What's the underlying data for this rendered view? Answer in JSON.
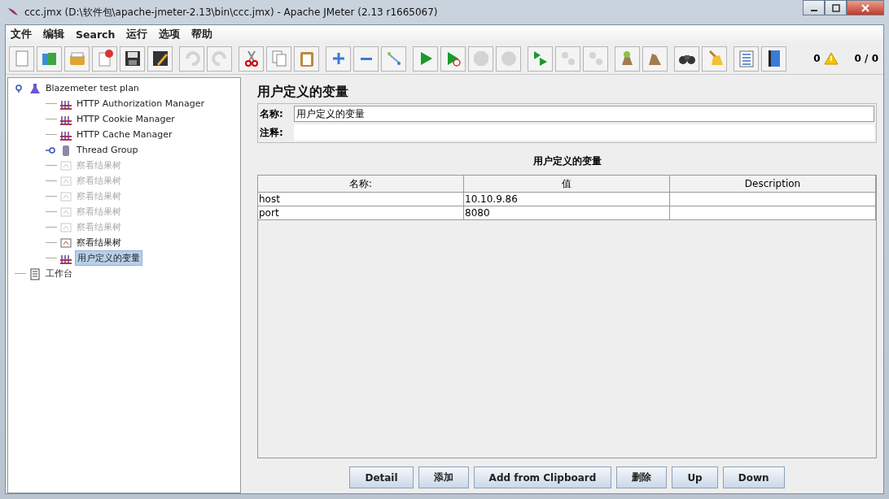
{
  "window": {
    "title": "ccc.jmx (D:\\软件包\\apache-jmeter-2.13\\bin\\ccc.jmx) - Apache JMeter (2.13 r1665067)"
  },
  "menu": [
    "文件",
    "编辑",
    "Search",
    "运行",
    "选项",
    "帮助"
  ],
  "toolbar": [
    [
      {
        "kind": "new",
        "disabled": false
      },
      {
        "kind": "templates",
        "disabled": false
      },
      {
        "kind": "open",
        "disabled": false
      },
      {
        "kind": "close",
        "disabled": false
      },
      {
        "kind": "save",
        "disabled": false
      },
      {
        "kind": "save-as",
        "disabled": false
      }
    ],
    [
      {
        "kind": "undo",
        "disabled": true
      },
      {
        "kind": "redo",
        "disabled": true
      }
    ],
    [
      {
        "kind": "cut",
        "disabled": false
      },
      {
        "kind": "copy",
        "disabled": false
      },
      {
        "kind": "paste",
        "disabled": false
      }
    ],
    [
      {
        "kind": "expand",
        "disabled": false
      },
      {
        "kind": "collapse",
        "disabled": false
      },
      {
        "kind": "toggle",
        "disabled": false
      }
    ],
    [
      {
        "kind": "start",
        "disabled": false
      },
      {
        "kind": "start-no-pause",
        "disabled": false
      },
      {
        "kind": "stop",
        "disabled": true
      },
      {
        "kind": "shutdown",
        "disabled": true
      }
    ],
    [
      {
        "kind": "remote-start",
        "disabled": false
      },
      {
        "kind": "remote-stop",
        "disabled": true
      },
      {
        "kind": "remote-exit",
        "disabled": true
      }
    ],
    [
      {
        "kind": "clear",
        "disabled": false
      },
      {
        "kind": "clear-all",
        "disabled": false
      }
    ],
    [
      {
        "kind": "search",
        "disabled": false
      },
      {
        "kind": "reset-search",
        "disabled": false
      }
    ],
    [
      {
        "kind": "functions",
        "disabled": false
      },
      {
        "kind": "help",
        "disabled": false
      }
    ]
  ],
  "status": {
    "warnings": "0",
    "threads": "0 / 0"
  },
  "tree": [
    {
      "label": "Blazemeter test plan",
      "kind": "plan",
      "expanded": true,
      "disabled": false,
      "selected": false,
      "children": [
        {
          "label": "HTTP Authorization Manager",
          "kind": "config",
          "disabled": false,
          "selected": false
        },
        {
          "label": "HTTP Cookie Manager",
          "kind": "config",
          "disabled": false,
          "selected": false
        },
        {
          "label": "HTTP Cache Manager",
          "kind": "config",
          "disabled": false,
          "selected": false
        },
        {
          "label": "Thread Group",
          "kind": "thread",
          "expanded": false,
          "disabled": false,
          "selected": false
        },
        {
          "label": "察看结果树",
          "kind": "listener",
          "disabled": true,
          "selected": false
        },
        {
          "label": "察看结果树",
          "kind": "listener",
          "disabled": true,
          "selected": false
        },
        {
          "label": "察看结果树",
          "kind": "listener",
          "disabled": true,
          "selected": false
        },
        {
          "label": "察看结果树",
          "kind": "listener",
          "disabled": true,
          "selected": false
        },
        {
          "label": "察看结果树",
          "kind": "listener",
          "disabled": true,
          "selected": false
        },
        {
          "label": "察看结果树",
          "kind": "listener",
          "disabled": false,
          "selected": false
        },
        {
          "label": "用户定义的变量",
          "kind": "config",
          "disabled": false,
          "selected": true
        }
      ]
    },
    {
      "label": "工作台",
      "kind": "workbench",
      "disabled": false,
      "selected": false
    }
  ],
  "panel": {
    "title": "用户定义的变量",
    "name_label": "名称:",
    "name_value": "用户定义的变量",
    "comment_label": "注释:",
    "table": {
      "caption": "用户定义的变量",
      "columns": [
        "名称:",
        "值",
        "Description"
      ],
      "rows": [
        [
          "host",
          "10.10.9.86",
          null
        ],
        [
          "port",
          "8080",
          null
        ]
      ]
    },
    "buttons": [
      "Detail",
      "添加",
      "Add from Clipboard",
      "删除",
      "Up",
      "Down"
    ]
  }
}
